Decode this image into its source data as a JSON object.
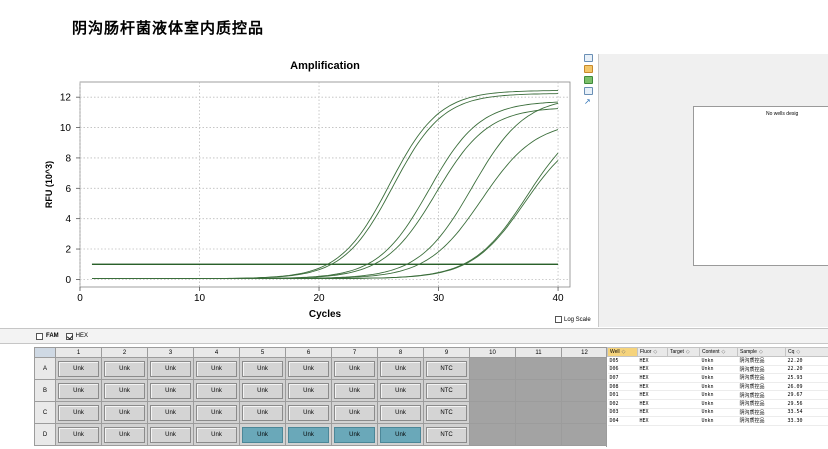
{
  "document_title": "阴沟肠杆菌液体室内质控品",
  "chart": {
    "title": "Amplification",
    "xlabel": "Cycles",
    "ylabel": "RFU (10^3)",
    "log_scale_label": "Log Scale",
    "log_scale_checked": false
  },
  "chart_data": {
    "type": "line",
    "title": "Amplification",
    "xlabel": "Cycles",
    "ylabel": "RFU (10^3)",
    "xlim": [
      0,
      41
    ],
    "ylim": [
      -0.5,
      13
    ],
    "xticks": [
      0,
      10,
      20,
      30,
      40
    ],
    "yticks": [
      0,
      2,
      4,
      6,
      8,
      10,
      12
    ],
    "grid": true,
    "threshold": 1.0,
    "baseline_start": 0.1,
    "curves": [
      {
        "midpoint": 25.9,
        "plateau": 12.4,
        "slope": 0.48
      },
      {
        "midpoint": 26.2,
        "plateau": 12.2,
        "slope": 0.48
      },
      {
        "midpoint": 29.2,
        "plateau": 11.7,
        "slope": 0.47
      },
      {
        "midpoint": 29.8,
        "plateau": 11.3,
        "slope": 0.46
      },
      {
        "midpoint": 32.8,
        "plateau": 12.0,
        "slope": 0.45
      },
      {
        "midpoint": 33.6,
        "plateau": 10.4,
        "slope": 0.44
      },
      {
        "midpoint": 37.4,
        "plateau": 10.9,
        "slope": 0.44
      },
      {
        "midpoint": 37.2,
        "plateau": 10.0,
        "slope": 0.45
      }
    ]
  },
  "no_wells_text": "No wells desig",
  "fluor": {
    "fam": {
      "label": "FAM",
      "checked": false
    },
    "hex": {
      "label": "HEX",
      "checked": true
    }
  },
  "plate": {
    "columns": [
      "1",
      "2",
      "3",
      "4",
      "5",
      "6",
      "7",
      "8",
      "9",
      "10",
      "11",
      "12"
    ],
    "rows": [
      {
        "label": "A",
        "wells": [
          "Unk",
          "Unk",
          "Unk",
          "Unk",
          "Unk",
          "Unk",
          "Unk",
          "Unk",
          "NTC"
        ],
        "selected": [
          false,
          false,
          false,
          false,
          false,
          false,
          false,
          false,
          false
        ]
      },
      {
        "label": "B",
        "wells": [
          "Unk",
          "Unk",
          "Unk",
          "Unk",
          "Unk",
          "Unk",
          "Unk",
          "Unk",
          "NTC"
        ],
        "selected": [
          false,
          false,
          false,
          false,
          false,
          false,
          false,
          false,
          false
        ]
      },
      {
        "label": "C",
        "wells": [
          "Unk",
          "Unk",
          "Unk",
          "Unk",
          "Unk",
          "Unk",
          "Unk",
          "Unk",
          "NTC"
        ],
        "selected": [
          false,
          false,
          false,
          false,
          false,
          false,
          false,
          false,
          false
        ]
      },
      {
        "label": "D",
        "wells": [
          "Unk",
          "Unk",
          "Unk",
          "Unk",
          "Unk",
          "Unk",
          "Unk",
          "Unk",
          "NTC"
        ],
        "selected": [
          false,
          false,
          false,
          false,
          true,
          true,
          true,
          true,
          false
        ]
      }
    ]
  },
  "results": {
    "columns": [
      "Well",
      "Fluor",
      "Target",
      "Content",
      "Sample",
      "Cq"
    ],
    "rows": [
      [
        "D05",
        "HEX",
        "",
        "Unkn",
        "阴沟质控品",
        "22.20"
      ],
      [
        "D06",
        "HEX",
        "",
        "Unkn",
        "阴沟质控品",
        "22.20"
      ],
      [
        "D07",
        "HEX",
        "",
        "Unkn",
        "阴沟质控品",
        "25.93"
      ],
      [
        "D08",
        "HEX",
        "",
        "Unkn",
        "阴沟质控品",
        "26.09"
      ],
      [
        "D01",
        "HEX",
        "",
        "Unkn",
        "阴沟质控品",
        "29.67"
      ],
      [
        "D02",
        "HEX",
        "",
        "Unkn",
        "阴沟质控品",
        "29.56"
      ],
      [
        "D03",
        "HEX",
        "",
        "Unkn",
        "阴沟质控品",
        "33.54"
      ],
      [
        "D04",
        "HEX",
        "",
        "Unkn",
        "阴沟质控品",
        "33.30"
      ]
    ]
  },
  "colors": {
    "curve": "#3b6e3b",
    "threshold": "#0c4a0c",
    "grid": "#bdbdbd",
    "selected_well": "#6aa8b9",
    "empty_well": "#a3a3a3"
  }
}
